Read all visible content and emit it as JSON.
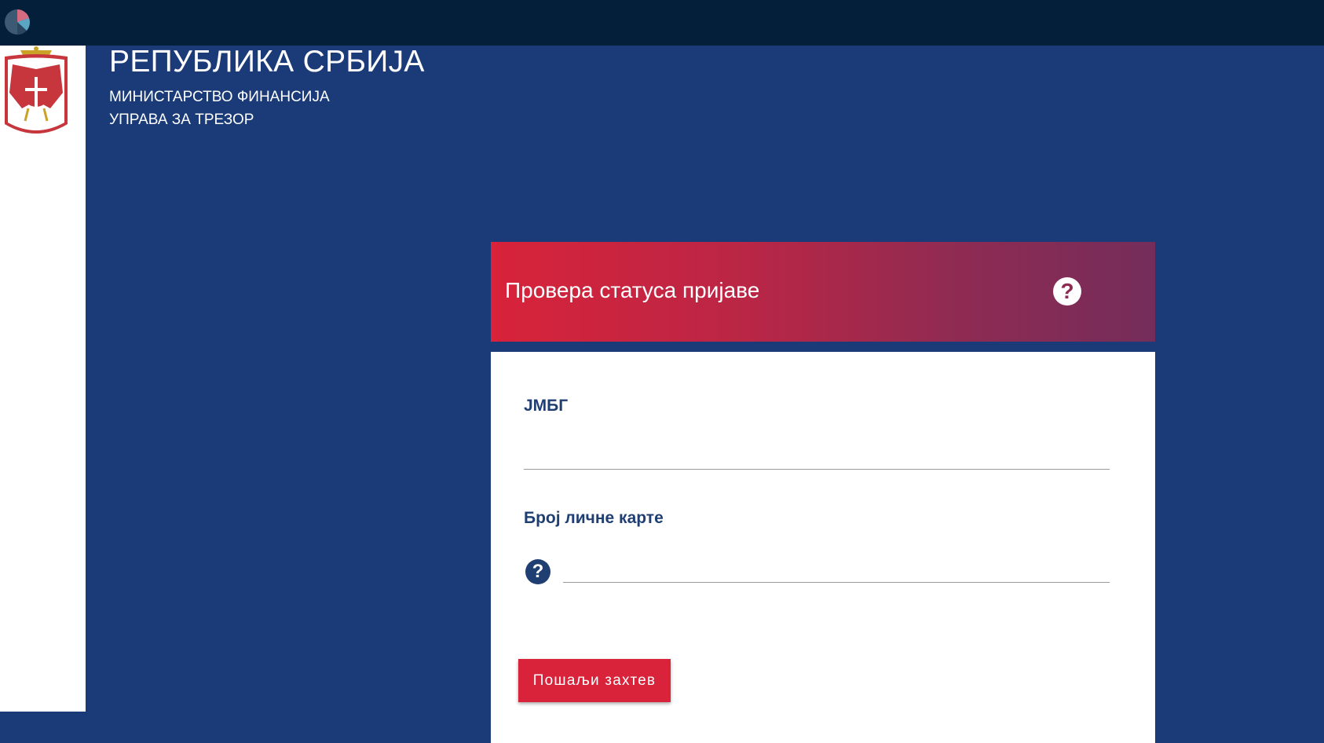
{
  "topbar": {
    "icon": "pie-chart-icon"
  },
  "header": {
    "coat_of_arms": "serbian-coat-of-arms-icon",
    "title": "РЕПУБЛИКА СРБИЈА",
    "ministry": "МИНИСТАРСТВО ФИНАНСИЈА",
    "administration": "УПРАВА ЗА ТРЕЗОР"
  },
  "form": {
    "title": "Провера статуса пријаве",
    "help_icon": "question-icon",
    "jmbg_label": "ЈМБГ",
    "jmbg_value": "",
    "id_card_label": "Број личне карте",
    "id_card_value": "",
    "submit_label": "Пошаљи захтев"
  },
  "colors": {
    "topbar": "#041f3a",
    "background": "#1a3b78",
    "accent_red": "#d8233a",
    "gradient_end": "#742d5a",
    "label_blue": "#1f3e72"
  }
}
